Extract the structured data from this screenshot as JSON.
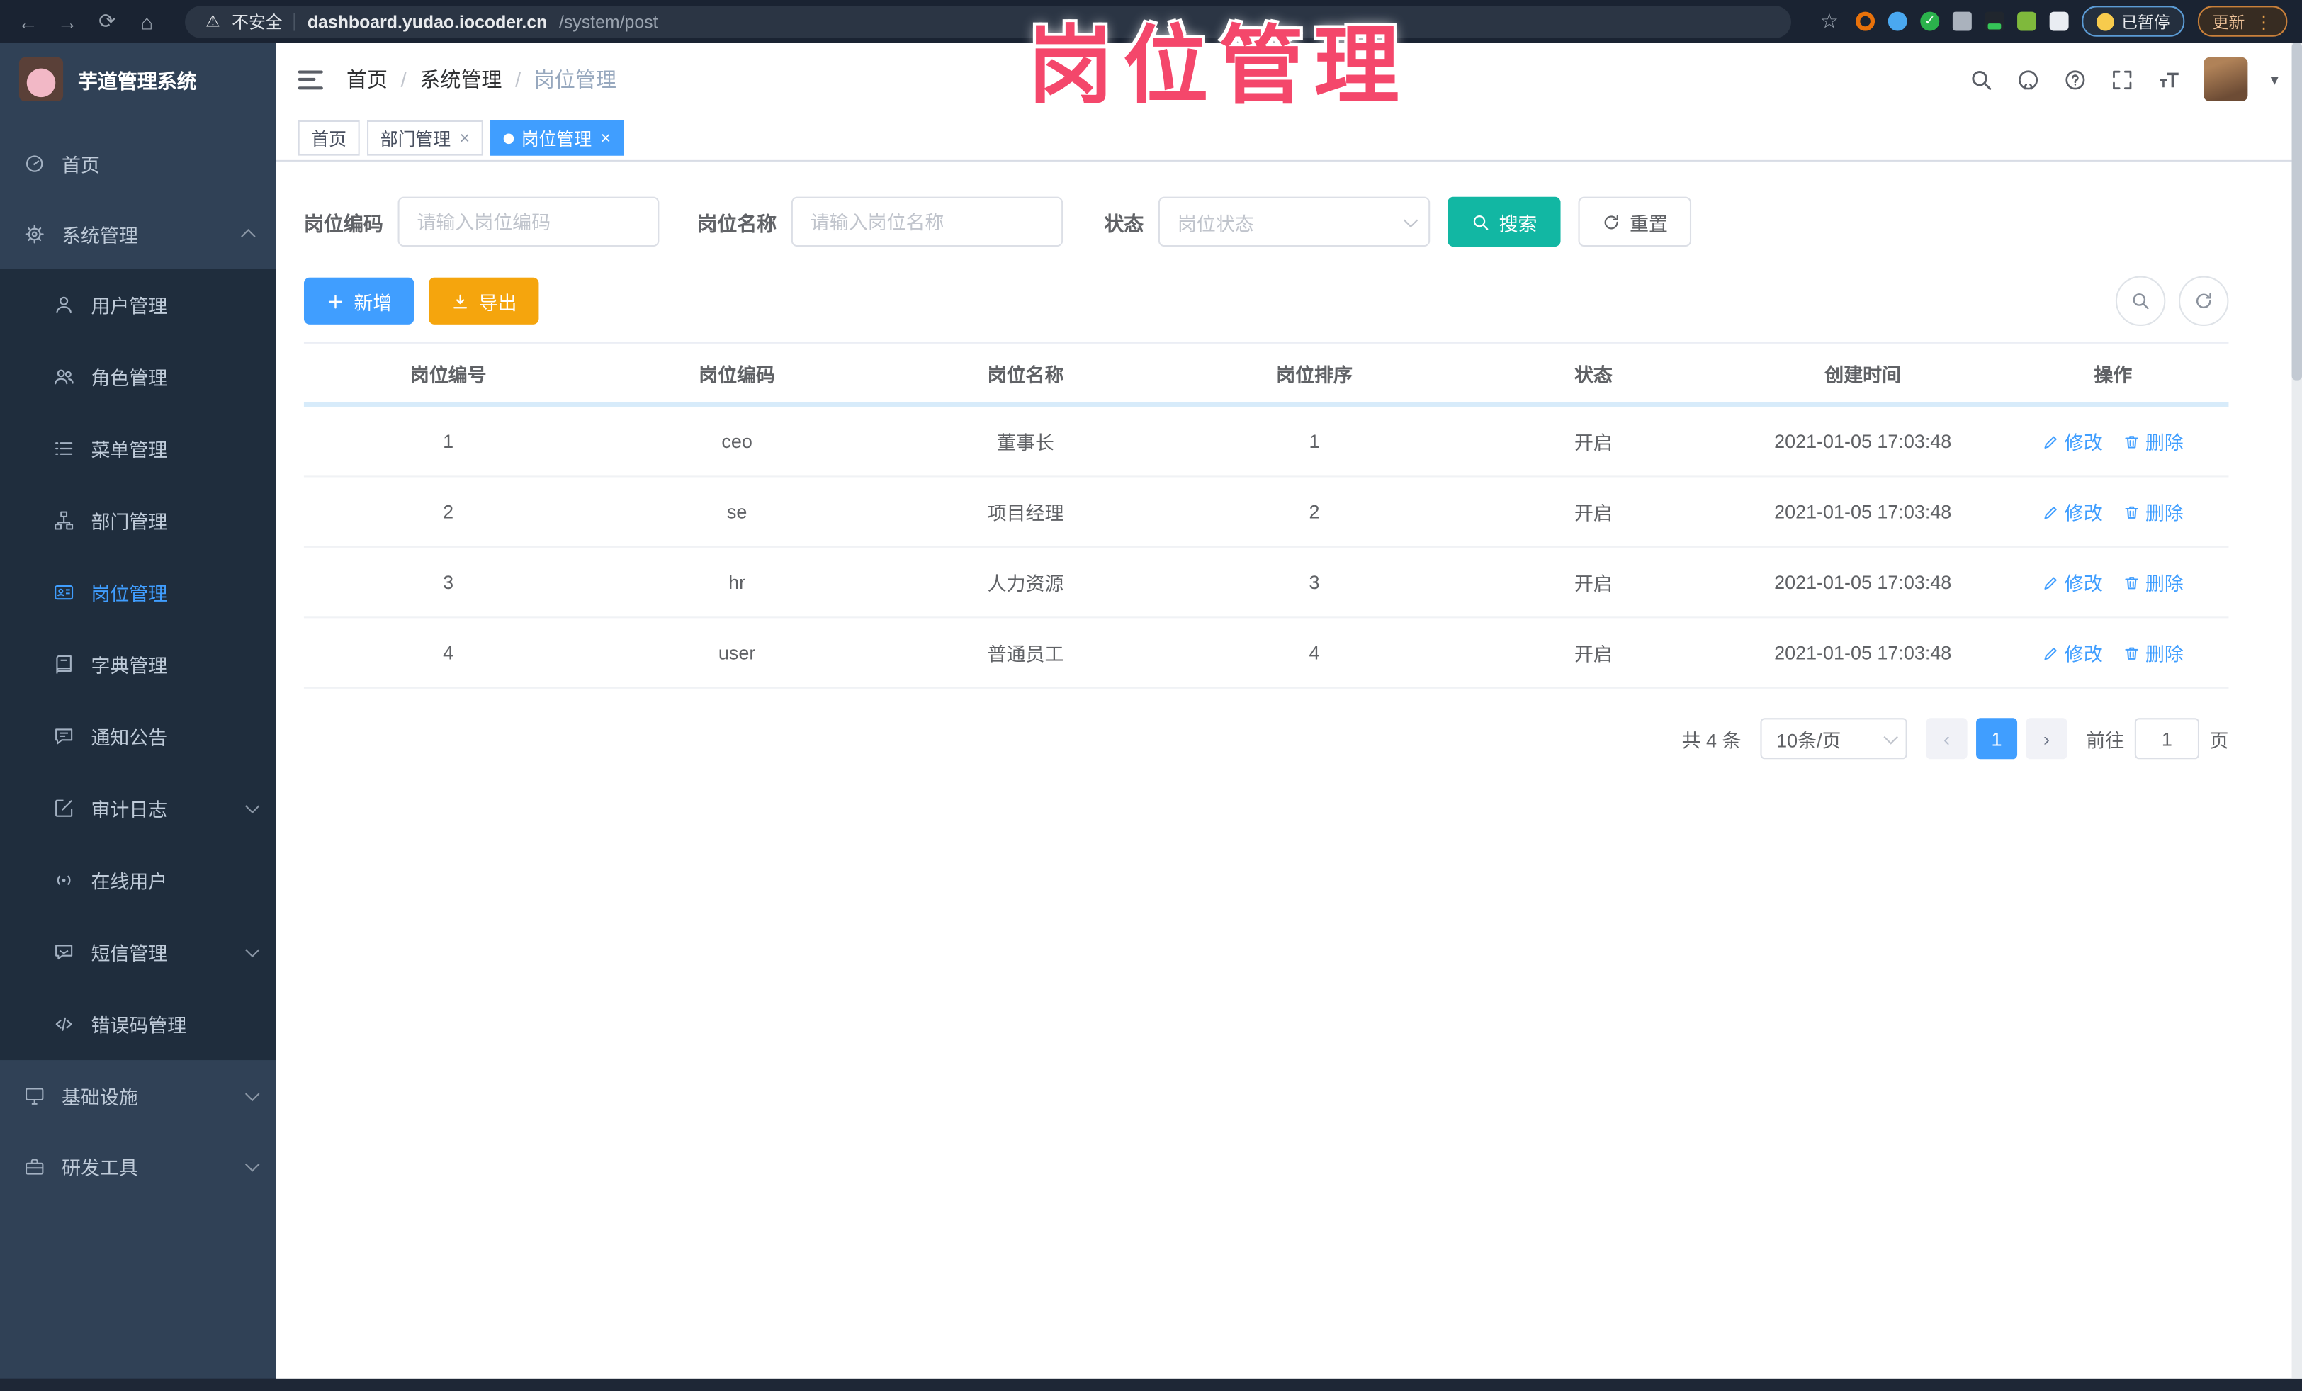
{
  "browser": {
    "security_label": "不安全",
    "url_host": "dashboard.yudao.iocoder.cn",
    "url_path": "/system/post",
    "paused_chip": "已暂停",
    "update_button": "更新"
  },
  "overlay": {
    "title": "岗位管理"
  },
  "icons": {
    "back": "←",
    "forward": "→",
    "reload": "⟳",
    "home": "⌂",
    "warning": "⚠",
    "star": "☆",
    "more": "⋮",
    "caret_down": "▾",
    "prev": "‹",
    "next": "›",
    "divider": "|"
  },
  "sidebar": {
    "app_title": "芋道管理系统",
    "items": [
      {
        "label": "首页",
        "icon": "gauge",
        "level": "top"
      },
      {
        "label": "系统管理",
        "icon": "gear",
        "level": "top",
        "chevron": "up",
        "open": true
      },
      {
        "label": "用户管理",
        "icon": "user",
        "level": "sub"
      },
      {
        "label": "角色管理",
        "icon": "users",
        "level": "sub"
      },
      {
        "label": "菜单管理",
        "icon": "list",
        "level": "sub"
      },
      {
        "label": "部门管理",
        "icon": "tree",
        "level": "sub"
      },
      {
        "label": "岗位管理",
        "icon": "badge",
        "level": "sub",
        "active": true
      },
      {
        "label": "字典管理",
        "icon": "book",
        "level": "sub"
      },
      {
        "label": "通知公告",
        "icon": "megaphone",
        "level": "sub"
      },
      {
        "label": "审计日志",
        "icon": "edit",
        "level": "sub",
        "chevron": "down"
      },
      {
        "label": "在线用户",
        "icon": "signal",
        "level": "sub"
      },
      {
        "label": "短信管理",
        "icon": "message",
        "level": "sub",
        "chevron": "down"
      },
      {
        "label": "错误码管理",
        "icon": "code",
        "level": "sub"
      },
      {
        "label": "基础设施",
        "icon": "monitor",
        "level": "top",
        "chevron": "down"
      },
      {
        "label": "研发工具",
        "icon": "toolbox",
        "level": "top",
        "chevron": "down"
      }
    ]
  },
  "header": {
    "breadcrumb": [
      "首页",
      "系统管理",
      "岗位管理"
    ]
  },
  "tabs": [
    {
      "label": "首页",
      "active": false,
      "closable": false
    },
    {
      "label": "部门管理",
      "active": false,
      "closable": true
    },
    {
      "label": "岗位管理",
      "active": true,
      "closable": true
    }
  ],
  "filters": {
    "code_label": "岗位编码",
    "code_placeholder": "请输入岗位编码",
    "name_label": "岗位名称",
    "name_placeholder": "请输入岗位名称",
    "status_label": "状态",
    "status_placeholder": "岗位状态",
    "search_label": "搜索",
    "reset_label": "重置"
  },
  "toolbar": {
    "add_label": "新增",
    "export_label": "导出"
  },
  "table": {
    "columns": [
      "岗位编号",
      "岗位编码",
      "岗位名称",
      "岗位排序",
      "状态",
      "创建时间",
      "操作"
    ],
    "rows": [
      {
        "id": "1",
        "code": "ceo",
        "name": "董事长",
        "sort": "1",
        "status": "开启",
        "created": "2021-01-05 17:03:48"
      },
      {
        "id": "2",
        "code": "se",
        "name": "项目经理",
        "sort": "2",
        "status": "开启",
        "created": "2021-01-05 17:03:48"
      },
      {
        "id": "3",
        "code": "hr",
        "name": "人力资源",
        "sort": "3",
        "status": "开启",
        "created": "2021-01-05 17:03:48"
      },
      {
        "id": "4",
        "code": "user",
        "name": "普通员工",
        "sort": "4",
        "status": "开启",
        "created": "2021-01-05 17:03:48"
      }
    ],
    "edit_label": "修改",
    "delete_label": "删除"
  },
  "pagination": {
    "total": "共 4 条",
    "page_size": "10条/页",
    "current_page": "1",
    "goto_prefix": "前往",
    "goto_value": "1",
    "goto_suffix": "页"
  },
  "colors": {
    "accent": "#409EFF",
    "search_button": "#12b7a3",
    "export_button": "#f5a50d",
    "overlay_pink": "#f4476b",
    "sidebar_bg": "#304156",
    "submenu_bg": "#1f2d3d",
    "topbar_bg": "#1a2332",
    "tag_active": "#409EFF"
  }
}
